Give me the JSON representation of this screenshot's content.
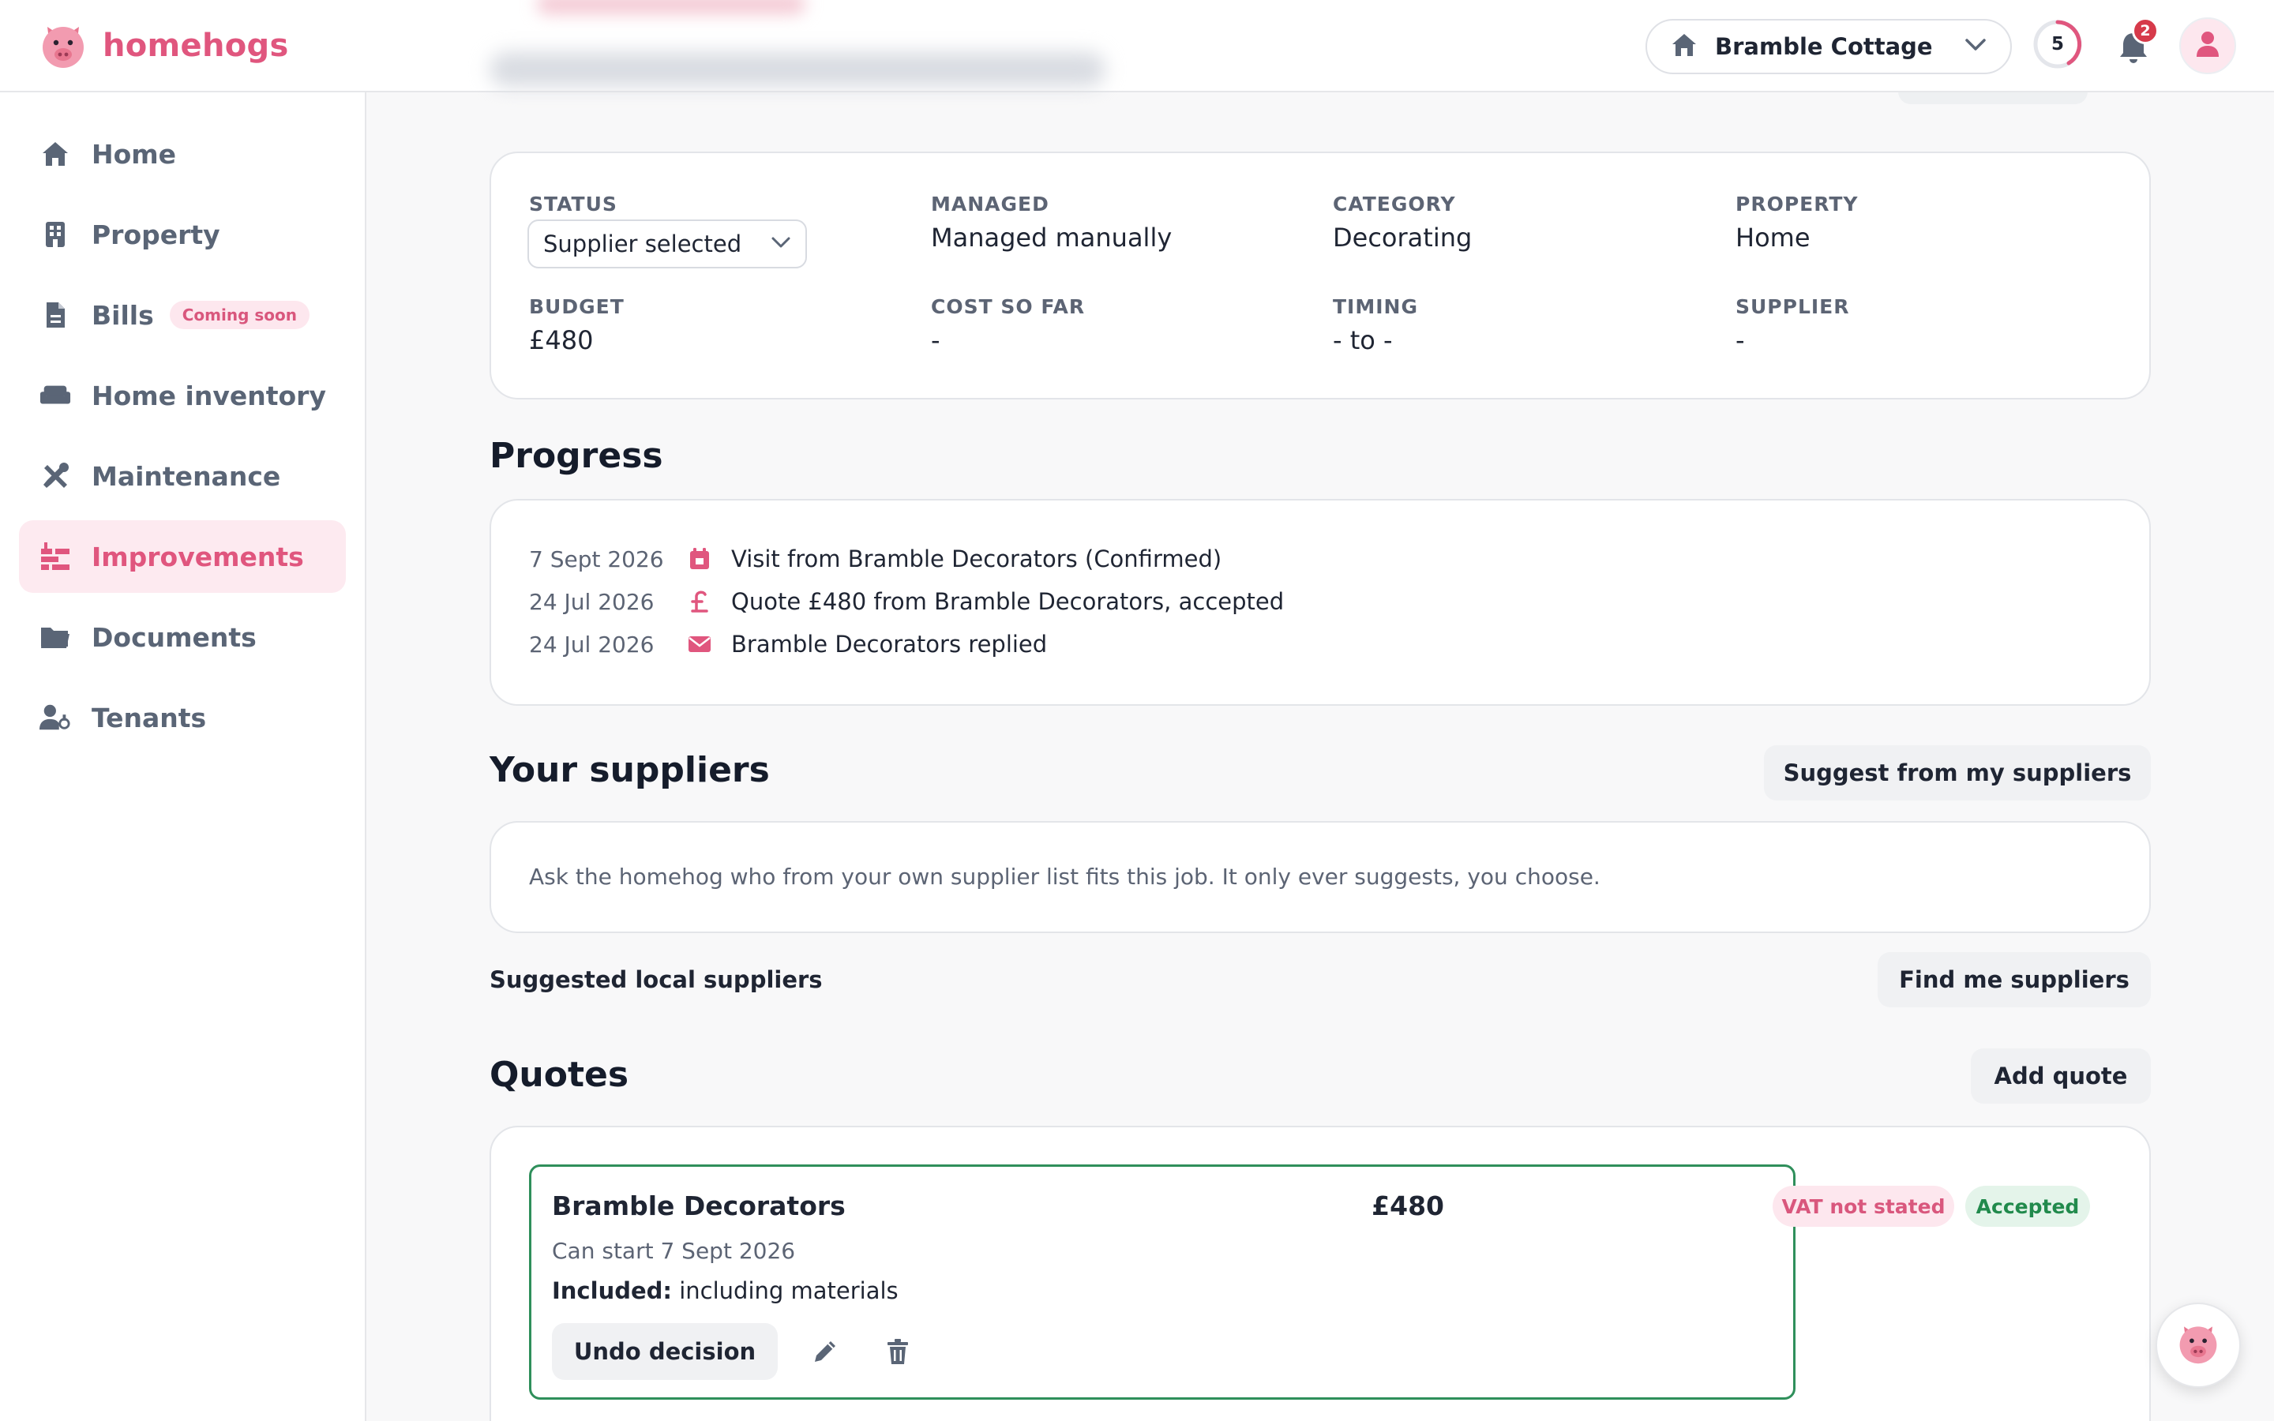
{
  "brand": {
    "name": "homehogs"
  },
  "header": {
    "property_selector": "Bramble Cottage",
    "progress_count": "5",
    "notification_count": "2"
  },
  "sidebar": {
    "items": [
      {
        "label": "Home",
        "icon": "home-icon"
      },
      {
        "label": "Property",
        "icon": "building-icon"
      },
      {
        "label": "Bills",
        "icon": "document-icon",
        "badge": "Coming soon"
      },
      {
        "label": "Home inventory",
        "icon": "sofa-icon"
      },
      {
        "label": "Maintenance",
        "icon": "tools-icon"
      },
      {
        "label": "Improvements",
        "icon": "improvements-icon",
        "active": true
      },
      {
        "label": "Documents",
        "icon": "folder-icon"
      },
      {
        "label": "Tenants",
        "icon": "tenant-icon"
      }
    ]
  },
  "details": {
    "status_label": "STATUS",
    "status_value": "Supplier selected",
    "managed_label": "MANAGED",
    "managed_value": "Managed manually",
    "category_label": "CATEGORY",
    "category_value": "Decorating",
    "property_label": "PROPERTY",
    "property_value": "Home",
    "budget_label": "BUDGET",
    "budget_value": "£480",
    "cost_label": "COST SO FAR",
    "cost_value": "-",
    "timing_label": "TIMING",
    "timing_value": "- to -",
    "supplier_label": "SUPPLIER",
    "supplier_value": "-"
  },
  "progress": {
    "title": "Progress",
    "events": [
      {
        "date": "7 Sept 2026",
        "icon": "calendar-icon",
        "text": "Visit from Bramble Decorators (Confirmed)"
      },
      {
        "date": "24 Jul 2026",
        "icon": "pound-icon",
        "text": "Quote £480 from Bramble Decorators, accepted"
      },
      {
        "date": "24 Jul 2026",
        "icon": "envelope-icon",
        "text": "Bramble Decorators replied"
      }
    ]
  },
  "suppliers": {
    "title": "Your suppliers",
    "suggest_button": "Suggest from my suppliers",
    "hint": "Ask the homehog who from your own supplier list fits this job. It only ever suggests, you choose.",
    "local_title": "Suggested local suppliers",
    "find_button": "Find me suppliers"
  },
  "quotes": {
    "title": "Quotes",
    "add_button": "Add quote",
    "items": [
      {
        "supplier": "Bramble Decorators",
        "price": "£480",
        "vat_badge": "VAT not stated",
        "status_badge": "Accepted",
        "start": "Can start 7 Sept 2026",
        "included_label": "Included:",
        "included_value": "including materials",
        "undo_button": "Undo decision"
      }
    ]
  },
  "colors": {
    "brand_pink": "#e0567e",
    "accepted_green": "#2f8f5b",
    "text_dark": "#1a2234",
    "text_muted": "#5c6474"
  }
}
